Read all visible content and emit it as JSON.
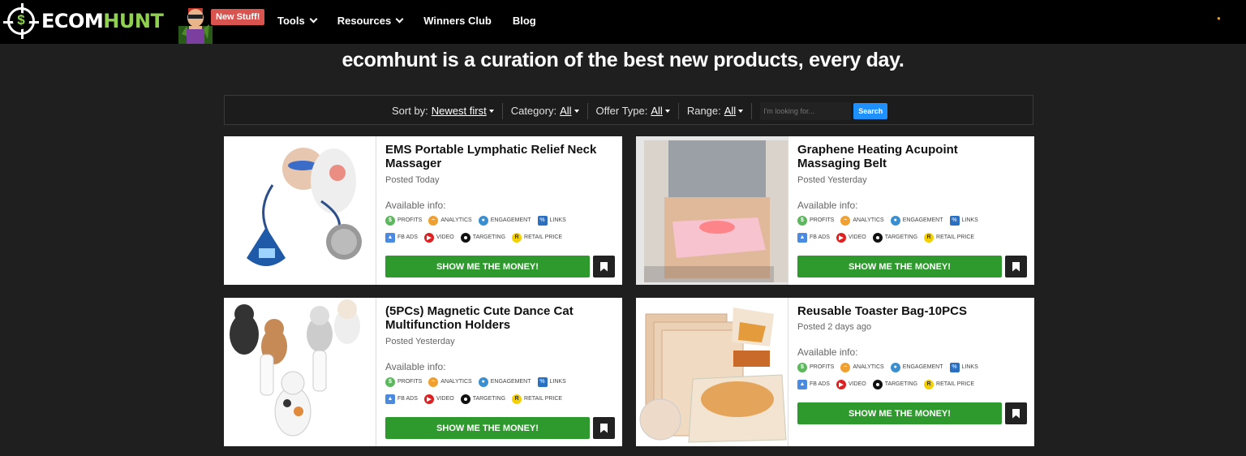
{
  "brand": {
    "logo_part1": "ECOM",
    "logo_part2": "HUNT",
    "logo_symbol": "$"
  },
  "nav": {
    "new_badge": "New Stuff!",
    "items": [
      {
        "label": "Tools",
        "dropdown": true
      },
      {
        "label": "Resources",
        "dropdown": true
      },
      {
        "label": "Winners Club",
        "dropdown": false
      },
      {
        "label": "Blog",
        "dropdown": false
      }
    ]
  },
  "hero": {
    "headline": "ecomhunt is a curation of the best new products, every day."
  },
  "filters": {
    "sort_label": "Sort by:",
    "sort_value": "Newest first",
    "category_label": "Category:",
    "category_value": "All",
    "offer_label": "Offer Type:",
    "offer_value": "All",
    "range_label": "Range:",
    "range_value": "All",
    "search_placeholder": "I'm looking for...",
    "search_button": "Search"
  },
  "info_labels": {
    "available": "Available info:",
    "profits": "PROFITS",
    "analytics": "ANALYTICS",
    "engagement": "ENGAGEMENT",
    "links": "LINKS",
    "fb_ads": "FB ADS",
    "video": "VIDEO",
    "targeting": "TARGETING",
    "retail_price": "RETAIL PRICE",
    "money_button": "SHOW ME THE MONEY!"
  },
  "products": [
    {
      "title": "EMS Portable Lymphatic Relief Neck Massager",
      "posted": "Posted Today"
    },
    {
      "title": "Graphene Heating Acupoint Massaging Belt",
      "posted": "Posted Yesterday"
    },
    {
      "title": "(5PCs) Magnetic Cute Dance Cat Multifunction Holders",
      "posted": "Posted Yesterday"
    },
    {
      "title": "Reusable Toaster Bag-10PCS",
      "posted": "Posted 2 days ago"
    }
  ],
  "colors": {
    "accent_green": "#8fd14f",
    "button_green": "#2e9a2e",
    "search_blue": "#1e90ff",
    "badge_red": "#d9534f"
  }
}
